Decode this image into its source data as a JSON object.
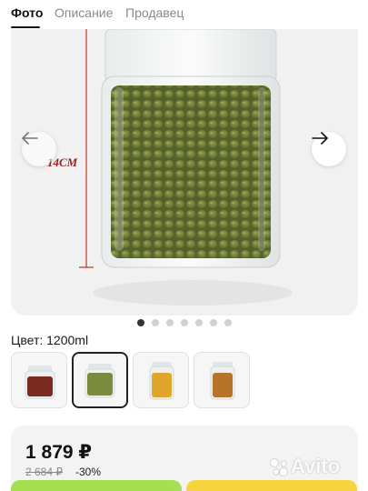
{
  "tabs": [
    {
      "label": "Фото",
      "active": true
    },
    {
      "label": "Описание",
      "active": false
    },
    {
      "label": "Продавец",
      "active": false
    }
  ],
  "gallery": {
    "measurement_label": "14CM",
    "prev_icon": "arrow-left-icon",
    "next_icon": "arrow-right-icon",
    "slide_count": 7,
    "active_slide": 1
  },
  "variant": {
    "label": "Цвет: 1200ml",
    "thumbnails": [
      {
        "name": "jar-red-beans",
        "fill": "#7a2a1e",
        "selected": false
      },
      {
        "name": "jar-mung-beans",
        "fill": "#7b8a3e",
        "selected": true
      },
      {
        "name": "jar-corn",
        "fill": "#e0a52a",
        "selected": false
      },
      {
        "name": "jar-spices",
        "fill": "#b8732a",
        "selected": false
      }
    ]
  },
  "price": {
    "current": "1 879 ₽",
    "old": "2 684 ₽",
    "discount": "-30%"
  },
  "watermark": "Avito",
  "colors": {
    "buy_green": "#a7df52",
    "buy_yellow": "#f7d33d",
    "bean_green": "#7b8a3e"
  }
}
